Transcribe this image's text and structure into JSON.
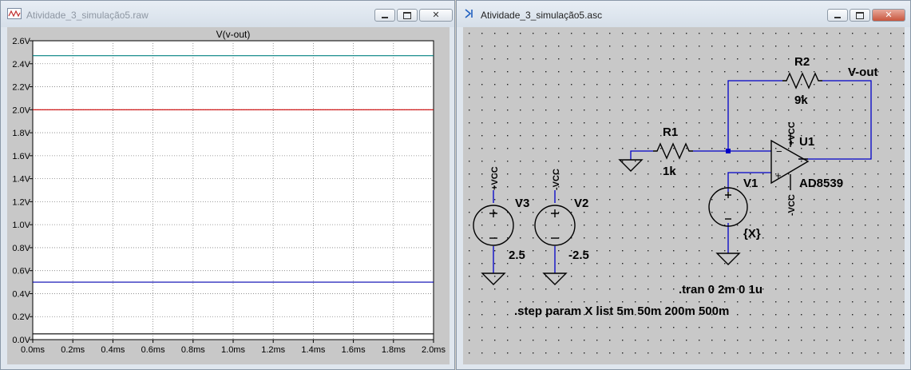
{
  "waveform_window": {
    "title": "Atividade_3_simulação5.raw",
    "icon": "waveform-icon",
    "buttons": {
      "minimize": "minimize-icon",
      "maximize": "restore-icon",
      "close": "✕"
    }
  },
  "chart_data": {
    "type": "line",
    "title": "V(v-out)",
    "xlim": [
      0,
      2.0
    ],
    "ylim": [
      0,
      2.6
    ],
    "x_ticks": [
      "0.0ms",
      "0.2ms",
      "0.4ms",
      "0.6ms",
      "0.8ms",
      "1.0ms",
      "1.2ms",
      "1.4ms",
      "1.6ms",
      "1.8ms",
      "2.0ms"
    ],
    "y_ticks": [
      "0.0V",
      "0.2V",
      "0.4V",
      "0.6V",
      "0.8V",
      "1.0V",
      "1.2V",
      "1.4V",
      "1.6V",
      "1.8V",
      "2.0V",
      "2.2V",
      "2.4V",
      "2.6V"
    ],
    "grid": true,
    "series": [
      {
        "color": "#008080",
        "x": [
          0,
          2.0
        ],
        "y": [
          2.47,
          2.47
        ]
      },
      {
        "color": "#cc0000",
        "x": [
          0,
          2.0
        ],
        "y": [
          2.0,
          2.0
        ]
      },
      {
        "color": "#0000b0",
        "x": [
          0,
          2.0
        ],
        "y": [
          0.5,
          0.5
        ]
      },
      {
        "color": "#000000",
        "x": [
          0,
          2.0
        ],
        "y": [
          0.05,
          0.05
        ]
      }
    ]
  },
  "schematic_window": {
    "title": "Atividade_3_simulação5.asc",
    "icon": "schematic-icon",
    "buttons": {
      "minimize": "minimize-icon",
      "maximize": "restore-icon",
      "close": "✕"
    }
  },
  "schematic": {
    "net_label": "V-out",
    "r2": {
      "name": "R2",
      "value": "9k"
    },
    "r1": {
      "name": "R1",
      "value": "1k"
    },
    "u1": {
      "name": "U1",
      "part": "AD8539",
      "pin_pos": "+VCC",
      "pin_neg": "-VCC",
      "plus": "+",
      "minus": "−"
    },
    "v1": {
      "name": "V1",
      "value": "{X}"
    },
    "v3": {
      "name": "V3",
      "value": "2.5",
      "label": "+VCC"
    },
    "v2": {
      "name": "V2",
      "value": "-2.5",
      "label": "-VCC"
    },
    "tran_cmd": ".tran 0 2m 0 1u",
    "step_cmd": ".step param X list 5m 50m 200m 500m"
  }
}
